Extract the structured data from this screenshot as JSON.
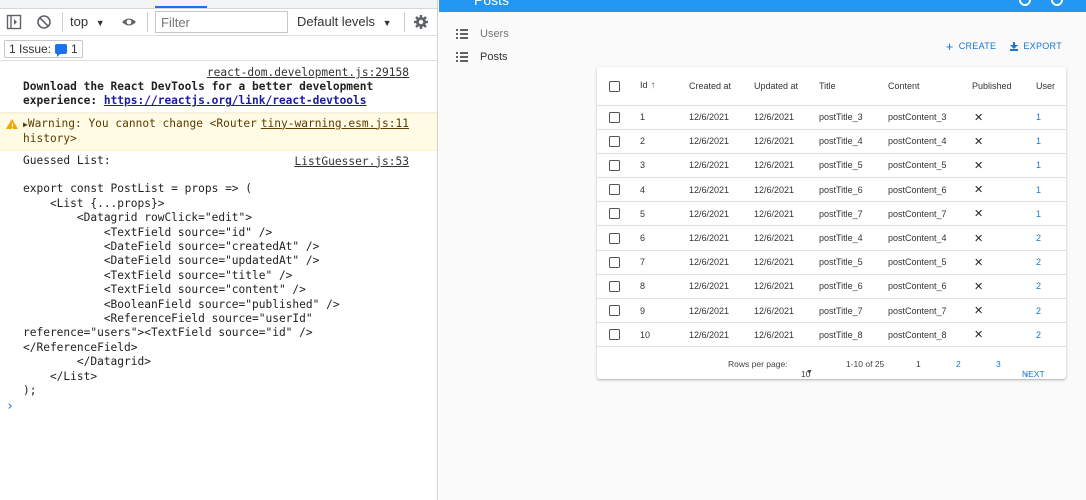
{
  "devtools": {
    "context": "top",
    "filter_placeholder": "Filter",
    "levels": "Default levels",
    "issues_label": "1 Issue:",
    "issues_count": "1",
    "messages": {
      "m1_src": "react-dom.development.js:29158",
      "m1_line1": "Download the React DevTools for a better development",
      "m1_line2_prefix": "experience: ",
      "m1_link": "https://reactjs.org/link/react-devtools",
      "warn_line1": "Warning: You cannot change <Router",
      "warn_src": "tiny-warning.esm.js:11",
      "warn_line2": "history>",
      "m3_text": "Guessed List:",
      "m3_src": "ListGuesser.js:53"
    },
    "code_lines": [
      "",
      "export const PostList = props => (",
      "    <List {...props}>",
      "        <Datagrid rowClick=\"edit\">",
      "            <TextField source=\"id\" />",
      "            <DateField source=\"createdAt\" />",
      "            <DateField source=\"updatedAt\" />",
      "            <TextField source=\"title\" />",
      "            <TextField source=\"content\" />",
      "            <BooleanField source=\"published\" />",
      "            <ReferenceField source=\"userId\"",
      "reference=\"users\"><TextField source=\"id\" />",
      "</ReferenceField>",
      "        </Datagrid>",
      "    </List>",
      ");"
    ],
    "prompt": "›"
  },
  "app": {
    "title": "Posts",
    "menu": [
      {
        "label": "Users",
        "icon": "list-icon"
      },
      {
        "label": "Posts",
        "icon": "list-icon"
      }
    ],
    "actions": {
      "create": "CREATE",
      "export": "EXPORT"
    },
    "table": {
      "headers": {
        "id": "Id",
        "created": "Created at",
        "updated": "Updated at",
        "title": "Title",
        "content": "Content",
        "published": "Published",
        "user": "User"
      },
      "rows": [
        {
          "id": "1",
          "created": "12/6/2021",
          "updated": "12/6/2021",
          "title": "postTitle_3",
          "content": "postContent_3",
          "published": "✕",
          "user": "1"
        },
        {
          "id": "2",
          "created": "12/6/2021",
          "updated": "12/6/2021",
          "title": "postTitle_4",
          "content": "postContent_4",
          "published": "✕",
          "user": "1"
        },
        {
          "id": "3",
          "created": "12/6/2021",
          "updated": "12/6/2021",
          "title": "postTitle_5",
          "content": "postContent_5",
          "published": "✕",
          "user": "1"
        },
        {
          "id": "4",
          "created": "12/6/2021",
          "updated": "12/6/2021",
          "title": "postTitle_6",
          "content": "postContent_6",
          "published": "✕",
          "user": "1"
        },
        {
          "id": "5",
          "created": "12/6/2021",
          "updated": "12/6/2021",
          "title": "postTitle_7",
          "content": "postContent_7",
          "published": "✕",
          "user": "1"
        },
        {
          "id": "6",
          "created": "12/6/2021",
          "updated": "12/6/2021",
          "title": "postTitle_4",
          "content": "postContent_4",
          "published": "✕",
          "user": "2"
        },
        {
          "id": "7",
          "created": "12/6/2021",
          "updated": "12/6/2021",
          "title": "postTitle_5",
          "content": "postContent_5",
          "published": "✕",
          "user": "2"
        },
        {
          "id": "8",
          "created": "12/6/2021",
          "updated": "12/6/2021",
          "title": "postTitle_6",
          "content": "postContent_6",
          "published": "✕",
          "user": "2"
        },
        {
          "id": "9",
          "created": "12/6/2021",
          "updated": "12/6/2021",
          "title": "postTitle_7",
          "content": "postContent_7",
          "published": "✕",
          "user": "2"
        },
        {
          "id": "10",
          "created": "12/6/2021",
          "updated": "12/6/2021",
          "title": "postTitle_8",
          "content": "postContent_8",
          "published": "✕",
          "user": "2"
        }
      ]
    },
    "pagination": {
      "rows_per_page_label": "Rows per page:",
      "rows_per_page": "10",
      "range": "1-10 of 25",
      "pages": [
        "1",
        "2",
        "3"
      ],
      "next": "NEXT"
    }
  },
  "colors": {
    "appbar": "#2196f3",
    "link": "#1976d2",
    "warning_bg": "#fffbe5"
  }
}
